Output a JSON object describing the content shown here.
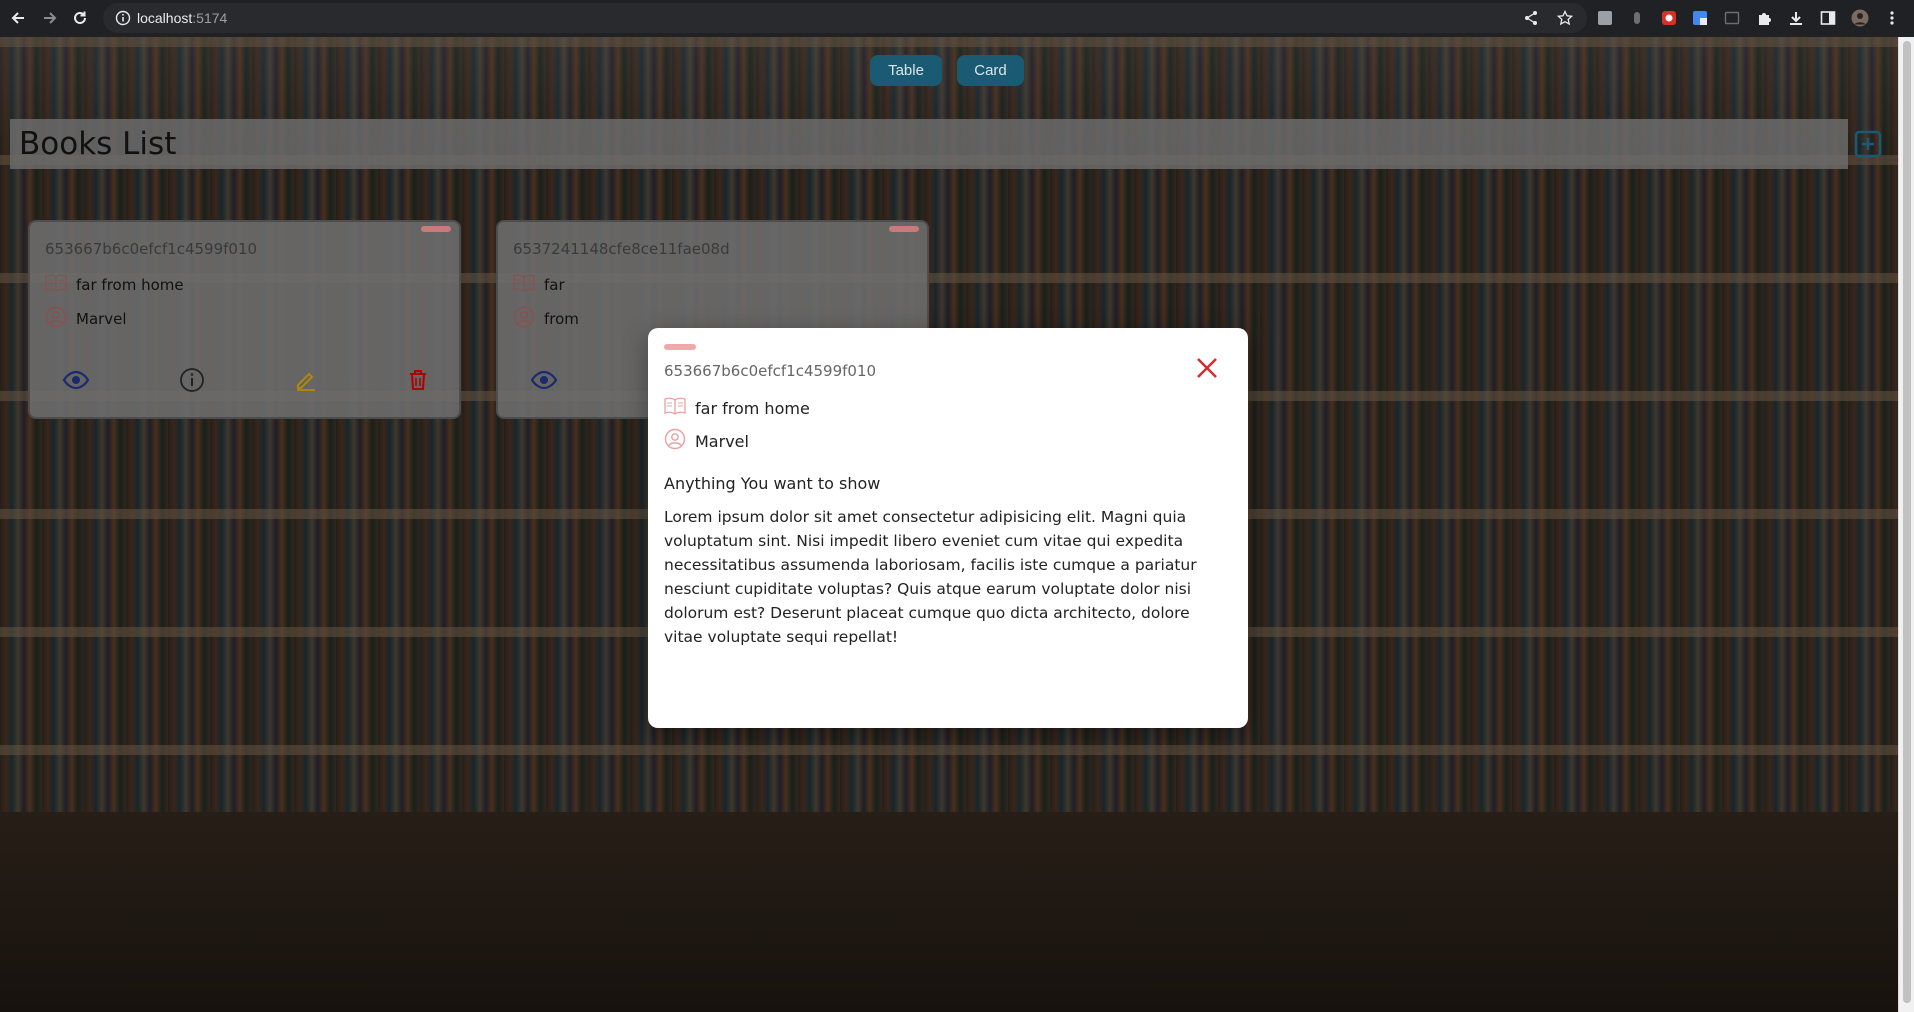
{
  "browser": {
    "url_host": "localhost",
    "url_port": ":5174"
  },
  "view_toggle": {
    "table_label": "Table",
    "card_label": "Card"
  },
  "header": {
    "title": "Books List"
  },
  "cards": [
    {
      "id": "653667b6c0efcf1c4599f010",
      "title": "far from home",
      "author": "Marvel"
    },
    {
      "id": "6537241148cfe8ce11fae08d",
      "title": "far",
      "author": "from"
    }
  ],
  "modal": {
    "id": "653667b6c0efcf1c4599f010",
    "title": "far from home",
    "author": "Marvel",
    "subtitle": "Anything You want to show",
    "body": "Lorem ipsum dolor sit amet consectetur adipisicing elit. Magni quia voluptatum sint. Nisi impedit libero eveniet cum vitae qui expedita necessitatibus assumenda laboriosam, facilis iste cumque a pariatur nesciunt cupiditate voluptas? Quis atque earum voluptate dolor nisi dolorum est? Deserunt placeat cumque quo dicta architecto, dolore vitae voluptate sequi repellat!"
  },
  "colors": {
    "toggle_bg": "#1b5a73",
    "view_icon": "#1a2a6c",
    "edit_icon": "#b88a00",
    "delete_icon": "#b00000",
    "close_icon": "#d32f2f",
    "book_icon": "#e8a0a0"
  }
}
